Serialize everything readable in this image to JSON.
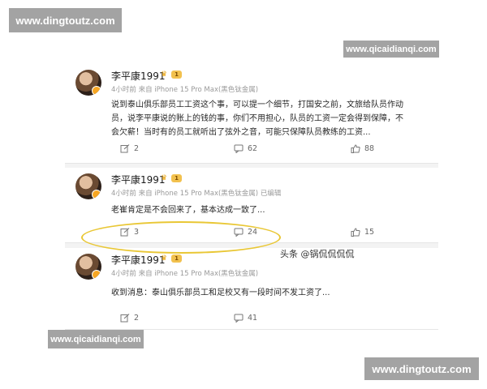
{
  "watermarks": {
    "top_left": "www.dingtoutz.com",
    "top_right": "www.qicaidianqi.com",
    "bottom_left": "www.qicaidianqi.com",
    "bottom_right": "www.dingtoutz.com"
  },
  "posts": [
    {
      "author": "李平康1991",
      "level": "1",
      "meta": "4小时前 来自 iPhone 15 Pro Max(黑色钛金属)",
      "lines": [
        "说到泰山俱乐部员工工资这个事，可以提一个细节，打国安之前，文旅给队员作动",
        "员，说李平康说的账上的钱的事，你们不用担心，队员的工资一定会得到保障，不",
        "会欠薪！当时有的员工就听出了弦外之音，可能只保障队员教练的工资..."
      ],
      "reposts": "2",
      "comments": "62",
      "likes": "88"
    },
    {
      "author": "李平康1991",
      "level": "1",
      "meta": "4小时前 来自 iPhone 15 Pro Max(黑色钛金属) 已编辑",
      "lines": [
        "老崔肯定是不会回来了，基本达成一致了..."
      ],
      "reposts": "3",
      "comments": "24",
      "likes": "15"
    },
    {
      "author": "李平康1991",
      "level": "1",
      "meta": "4小时前 来自 iPhone 15 Pro Max(黑色钛金属)",
      "lines": [
        "收到消息：泰山俱乐部员工和足校又有一段时间不发工资了..."
      ],
      "reposts": "2",
      "comments": "41",
      "likes": ""
    }
  ],
  "source_label": "头条 @锅侃侃侃侃",
  "colors": {
    "highlight": "#e9c735",
    "watermark_bg": "#a3a3a3"
  }
}
